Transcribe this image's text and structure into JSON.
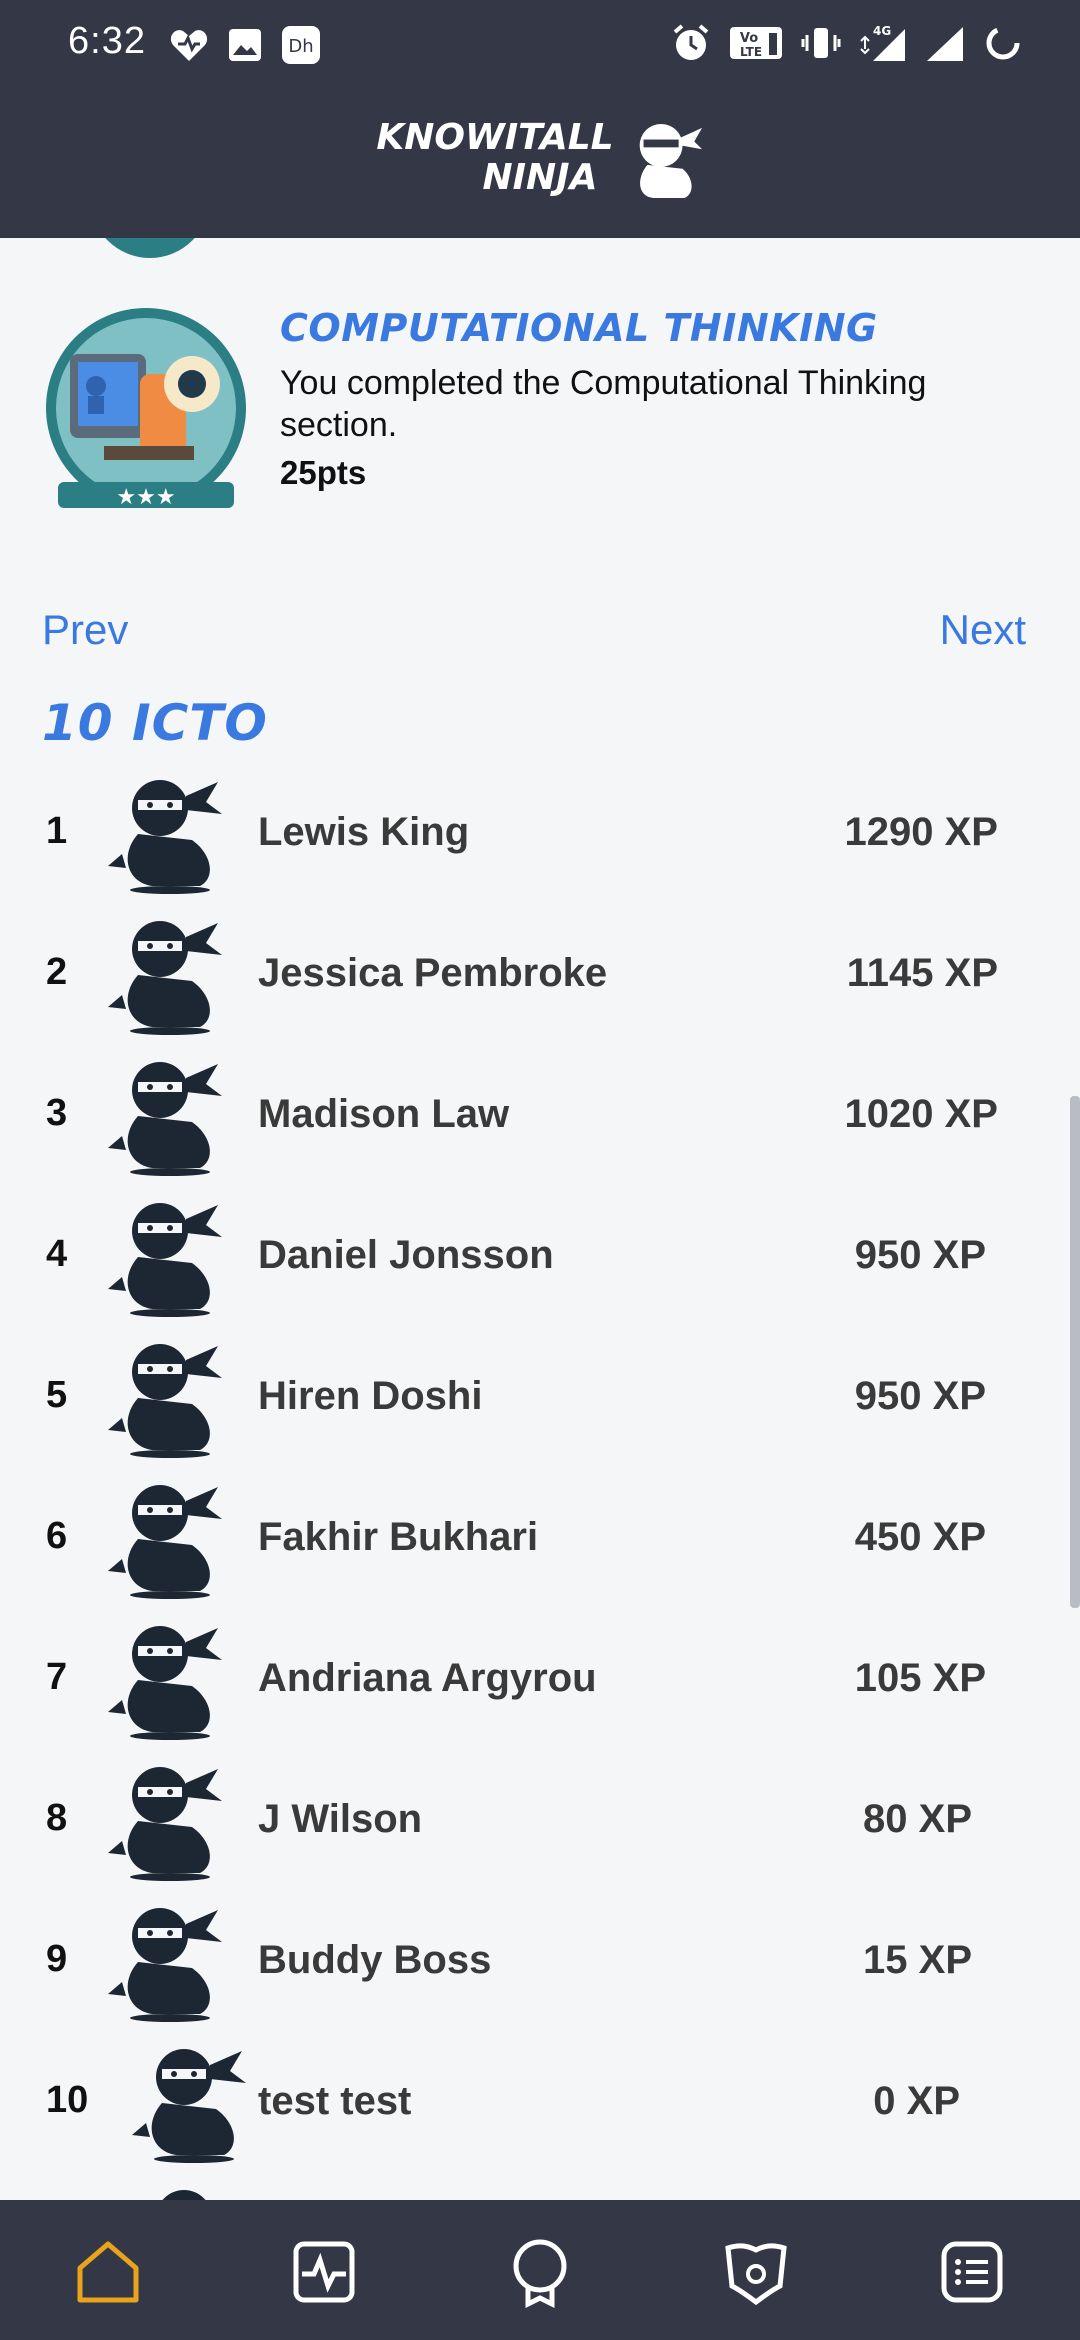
{
  "status_bar": {
    "time": "6:32",
    "left_icons": [
      "heart-icon",
      "image-icon",
      "disney-plus-hotstar-icon"
    ],
    "right_icons": [
      "alarm-icon",
      "volte-icon",
      "vibrate-icon",
      "signal-4g-icon",
      "signal-icon",
      "loading-icon"
    ]
  },
  "header": {
    "logo_line1": "KNOWITALL",
    "logo_line2": "NINJA"
  },
  "achievement": {
    "title": "COMPUTATIONAL THINKING",
    "description": "You completed the Computational Thinking section.",
    "points": "25pts"
  },
  "pager": {
    "prev_label": "Prev",
    "next_label": "Next"
  },
  "leaderboard": {
    "group_name": "10 ICTO",
    "rows": [
      {
        "rank": "1",
        "name": "Lewis King",
        "xp": "1290 XP"
      },
      {
        "rank": "2",
        "name": "Jessica Pembroke",
        "xp": "1145 XP"
      },
      {
        "rank": "3",
        "name": "Madison Law",
        "xp": "1020 XP"
      },
      {
        "rank": "4",
        "name": "Daniel Jonsson",
        "xp": "950 XP"
      },
      {
        "rank": "5",
        "name": "Hiren Doshi",
        "xp": "950 XP"
      },
      {
        "rank": "6",
        "name": "Fakhir Bukhari",
        "xp": "450 XP"
      },
      {
        "rank": "7",
        "name": "Andriana Argyrou",
        "xp": "105 XP"
      },
      {
        "rank": "8",
        "name": "J Wilson",
        "xp": "80 XP"
      },
      {
        "rank": "9",
        "name": "Buddy Boss",
        "xp": "15 XP"
      },
      {
        "rank": "10",
        "name": "test test",
        "xp": "0 XP"
      }
    ]
  },
  "bottom_nav": {
    "items": [
      "home-icon",
      "activity-icon",
      "badge-icon",
      "rewards-icon",
      "list-icon"
    ],
    "active": "home-icon",
    "active_color": "#e8a41c",
    "inactive_color": "#ffffff"
  },
  "colors": {
    "header_bg": "#343846",
    "accent_blue": "#3a7ae0",
    "page_bg": "#f5f6f8"
  }
}
